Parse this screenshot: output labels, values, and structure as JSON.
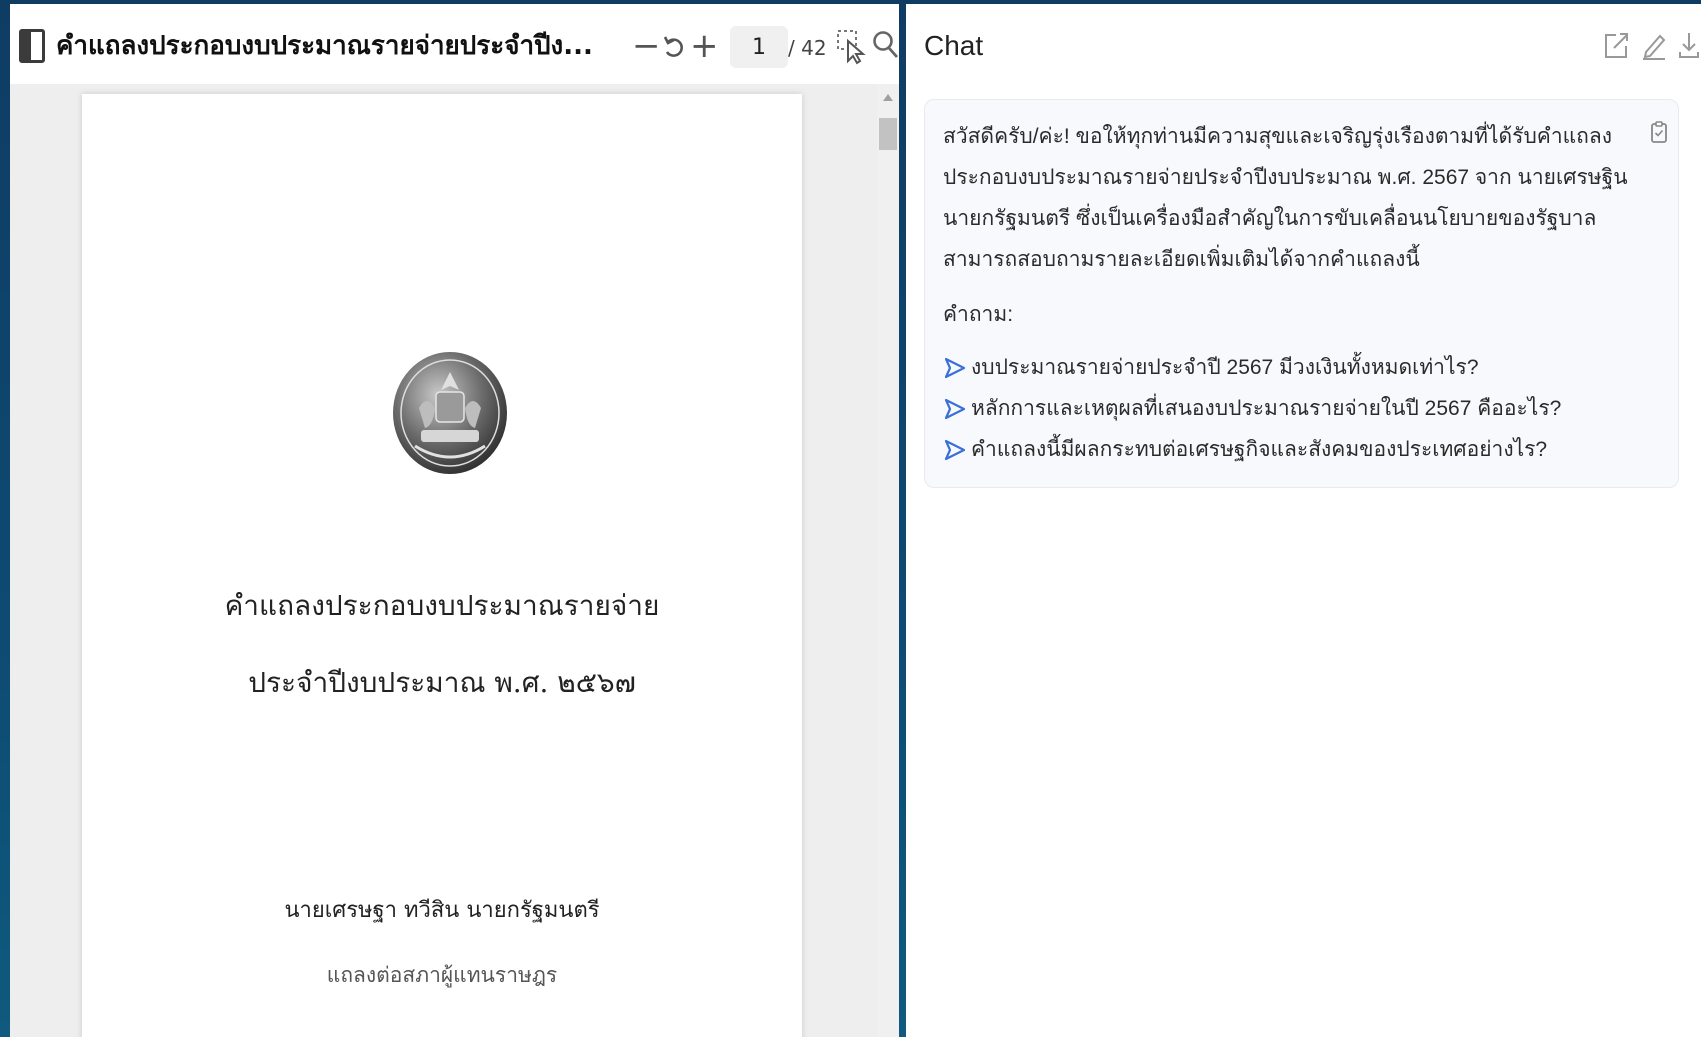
{
  "pdf_viewer": {
    "title": "คำแถลงประกอบงบประมาณรายจ่ายประจำปีง...",
    "zoom_out_label": "−",
    "zoom_in_label": "+",
    "current_page": "1",
    "total_pages": "/ 42",
    "page": {
      "title_line_1": "คำแถลงประกอบงบประมาณรายจ่าย",
      "title_line_2": "ประจำปีงบประมาณ พ.ศ. ๒๕๖๗",
      "author": "นายเศรษฐา ทวีสิน นายกรัฐมนตรี",
      "subtitle": "แถลงต่อสภาผู้แทนราษฎร"
    }
  },
  "chat": {
    "title": "Chat",
    "message": {
      "intro": "สวัสดีครับ/ค่ะ! ขอให้ทุกท่านมีความสุขและเจริญรุ่งเรืองตามที่ได้รับคำแถลงประกอบงบประมาณรายจ่ายประจำปีงบประมาณ พ.ศ. 2567 จาก นายเศรษฐิน นายกรัฐมนตรี ซึ่งเป็นเครื่องมือสำคัญในการขับเคลื่อนนโยบายของรัฐบาล สามารถสอบถามรายละเอียดเพิ่มเติมได้จากคำแถลงนี้",
      "questions_label": "คำถาม:",
      "questions": [
        "งบประมาณรายจ่ายประจำปี 2567 มีวงเงินทั้งหมดเท่าไร?",
        "หลักการและเหตุผลที่เสนองบประมาณรายจ่ายในปี 2567 คืออะไร?",
        "คำแถลงนี้มีผลกระทบต่อเศรษฐกิจและสังคมของประเทศอย่างไร?"
      ]
    }
  },
  "colors": {
    "accent": "#3b6fd8",
    "background": "#0f4a74"
  }
}
